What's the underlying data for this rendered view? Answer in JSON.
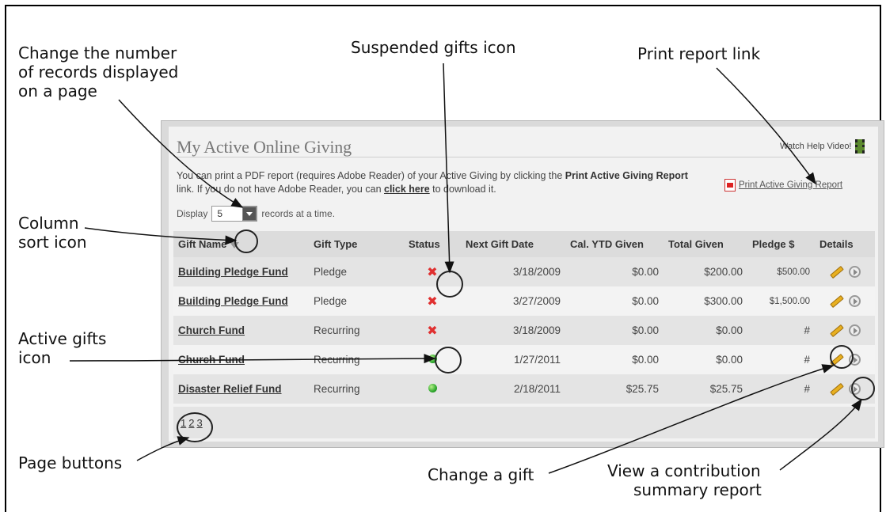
{
  "callouts": {
    "records_line1": "Change the number",
    "records_line2": "of records displayed",
    "records_line3": "on a page",
    "suspended": "Suspended gifts icon",
    "print_report": "Print report link",
    "sort_line1": "Column",
    "sort_line2": "sort icon",
    "active_line1": "Active gifts",
    "active_line2": "icon",
    "page_buttons": "Page buttons",
    "change_gift": "Change a gift",
    "view_line1": "View a contribution",
    "view_line2": "summary report"
  },
  "panel": {
    "title": "My Active Online Giving",
    "help_video": "Watch Help Video!",
    "intro_part1": "You can print a PDF report (requires Adobe Reader) of your Active Giving by clicking the ",
    "intro_bold": "Print Active Giving Report",
    "intro_part2": " link. If you do not have Adobe Reader, you can ",
    "intro_link": "click here",
    "intro_part3": " to download it.",
    "print_link": "Print Active Giving Report",
    "display_label": "Display",
    "display_value": "5",
    "display_suffix": "records at a time."
  },
  "table": {
    "headers": [
      "Gift Name",
      "Gift Type",
      "Status",
      "Next Gift Date",
      "Cal. YTD Given",
      "Total Given",
      "Pledge $",
      "Details"
    ],
    "rows": [
      {
        "name": "Building Pledge Fund",
        "type": "Pledge",
        "status": "suspended",
        "next": "3/18/2009",
        "ytd": "$0.00",
        "total": "$200.00",
        "pledge": "$500.00"
      },
      {
        "name": "Building Pledge Fund",
        "type": "Pledge",
        "status": "suspended",
        "next": "3/27/2009",
        "ytd": "$0.00",
        "total": "$300.00",
        "pledge": "$1,500.00"
      },
      {
        "name": "Church Fund",
        "type": "Recurring",
        "status": "suspended",
        "next": "3/18/2009",
        "ytd": "$0.00",
        "total": "$0.00",
        "pledge": "#"
      },
      {
        "name": "Church Fund",
        "type": "Recurring",
        "status": "active",
        "next": "1/27/2011",
        "ytd": "$0.00",
        "total": "$0.00",
        "pledge": "#"
      },
      {
        "name": "Disaster Relief Fund",
        "type": "Recurring",
        "status": "active",
        "next": "2/18/2011",
        "ytd": "$25.75",
        "total": "$25.75",
        "pledge": "#"
      }
    ]
  },
  "pager": {
    "pages": [
      "1",
      "2",
      "3"
    ]
  },
  "icons": {
    "sort": "sort-triangle-icon",
    "suspended": "red-x-icon",
    "active": "green-dot-icon",
    "edit": "pencil-icon",
    "view": "play-circle-icon",
    "pdf": "pdf-icon",
    "video": "film-strip-icon"
  },
  "colors": {
    "suspended": "#e03030",
    "active": "#2ea82e",
    "pencil": "#e8b020"
  }
}
